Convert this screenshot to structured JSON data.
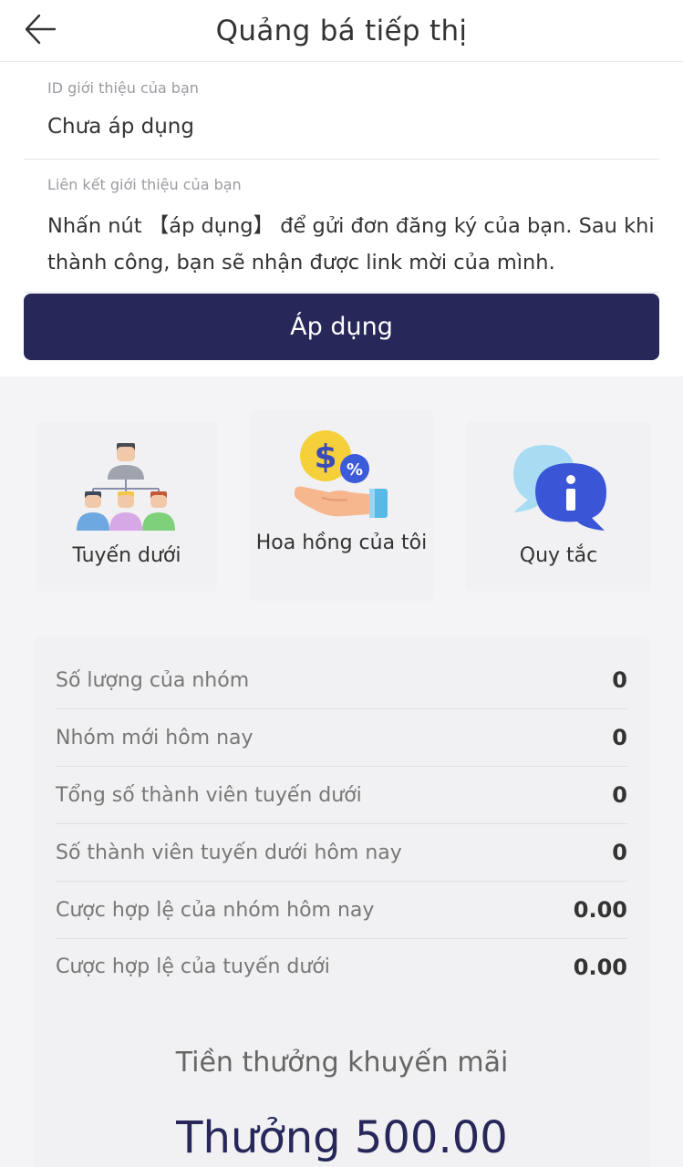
{
  "header": {
    "title": "Quảng bá tiếp thị"
  },
  "referral": {
    "id_label": "ID giới thiệu của bạn",
    "id_value": "Chưa áp dụng",
    "link_label": "Liên kết giới thiệu của bạn",
    "link_value": "Nhấn nút 【áp dụng】 để gửi đơn đăng ký của bạn. Sau khi thành công, bạn sẽ nhận được link mời của mình.",
    "apply_button": "Áp dụng"
  },
  "cards": [
    {
      "label": "Tuyến dưới",
      "icon": "team-hierarchy-icon"
    },
    {
      "label": "Hoa hồng của tôi",
      "icon": "commission-hand-icon"
    },
    {
      "label": "Quy tắc",
      "icon": "info-chat-icon"
    }
  ],
  "stats": [
    {
      "label": "Số lượng của nhóm",
      "value": "0"
    },
    {
      "label": "Nhóm mới hôm nay",
      "value": "0"
    },
    {
      "label": "Tổng số thành viên tuyến dưới",
      "value": "0"
    },
    {
      "label": "Số thành viên tuyến dưới hôm nay",
      "value": "0"
    },
    {
      "label": "Cược hợp lệ của nhóm hôm nay",
      "value": "0.00"
    },
    {
      "label": "Cược hợp lệ của tuyến dưới",
      "value": "0.00"
    }
  ],
  "promo": {
    "title": "Tiền thưởng khuyến mãi",
    "value": "Thưởng 500.00"
  },
  "colors": {
    "primary": "#27275a",
    "background": "#f4f4f6",
    "card": "#f1f1f3"
  }
}
